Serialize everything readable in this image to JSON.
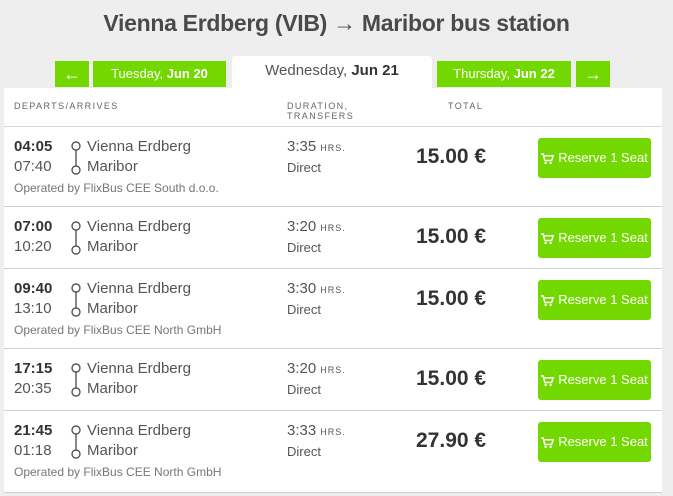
{
  "title": "Vienna Erdberg (VIB) → Maribor bus station",
  "nav": {
    "prev_arrow": "←",
    "next_arrow": "→",
    "prev_day": {
      "weekday": "Tuesday, ",
      "date": "Jun 20"
    },
    "current_day": {
      "weekday": "Wednesday, ",
      "date": "Jun 21"
    },
    "next_day": {
      "weekday": "Thursday, ",
      "date": "Jun 22"
    }
  },
  "columns": {
    "depart": "DEPARTS/ARRIVES",
    "duration_line1": "DURATION,",
    "duration_line2": "TRANSFERS",
    "total": "TOTAL"
  },
  "reserve_label": "Reserve 1 Seat",
  "hrs_label": "HRS.",
  "icons": {
    "route": "route-connector-icon",
    "cart": "cart-icon"
  },
  "colors": {
    "accent": "#73d700",
    "background": "#eeeeee"
  },
  "trips": [
    {
      "depart": "04:05",
      "arrive": "07:40",
      "from": "Vienna Erdberg",
      "to": "Maribor",
      "duration": "3:35",
      "transfers": "Direct",
      "price": "15.00 €",
      "operator": "Operated by FlixBus CEE South d.o.o."
    },
    {
      "depart": "07:00",
      "arrive": "10:20",
      "from": "Vienna Erdberg",
      "to": "Maribor",
      "duration": "3:20",
      "transfers": "Direct",
      "price": "15.00 €",
      "operator": ""
    },
    {
      "depart": "09:40",
      "arrive": "13:10",
      "from": "Vienna Erdberg",
      "to": "Maribor",
      "duration": "3:30",
      "transfers": "Direct",
      "price": "15.00 €",
      "operator": "Operated by FlixBus CEE North GmbH"
    },
    {
      "depart": "17:15",
      "arrive": "20:35",
      "from": "Vienna Erdberg",
      "to": "Maribor",
      "duration": "3:20",
      "transfers": "Direct",
      "price": "15.00 €",
      "operator": ""
    },
    {
      "depart": "21:45",
      "arrive": "01:18",
      "from": "Vienna Erdberg",
      "to": "Maribor",
      "duration": "3:33",
      "transfers": "Direct",
      "price": "27.90 €",
      "operator": "Operated by FlixBus CEE North GmbH"
    }
  ]
}
